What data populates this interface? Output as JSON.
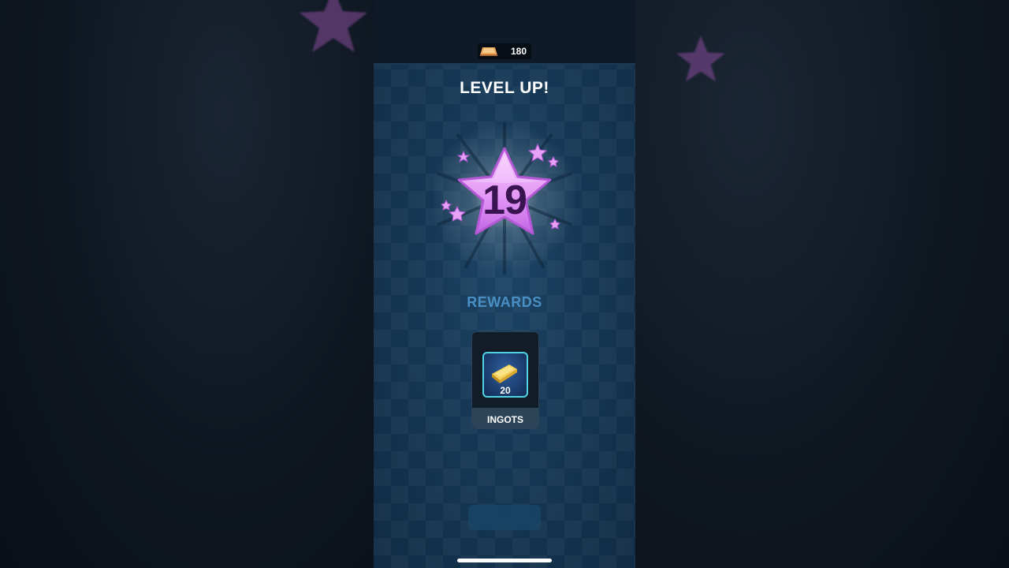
{
  "currency": {
    "icon": "ingot-icon",
    "amount": "180"
  },
  "title": "LEVEL UP!",
  "level": {
    "icon": "star-icon",
    "number": "19"
  },
  "rewards": {
    "label": "REWARDS",
    "items": [
      {
        "icon": "gold-ingot-icon",
        "quantity": "20",
        "name": "INGOTS"
      }
    ]
  },
  "colors": {
    "star": "#d98af0",
    "star_number": "#3a1450",
    "rewards_label": "#4a8fc4",
    "icon_border": "#4fd4e4",
    "panel": "#163754"
  }
}
